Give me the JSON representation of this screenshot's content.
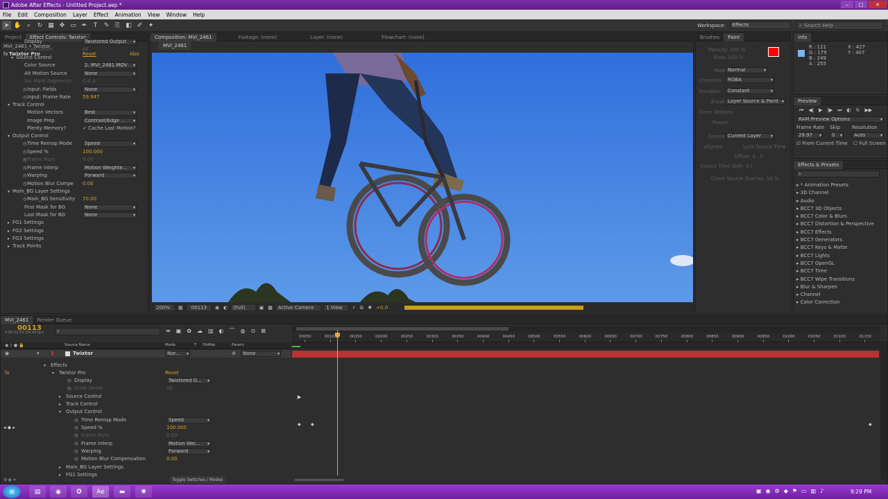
{
  "window_title": "Adobe After Effects - Untitled Project.aep *",
  "menu": [
    "File",
    "Edit",
    "Composition",
    "Layer",
    "Effect",
    "Animation",
    "View",
    "Window",
    "Help"
  ],
  "workspace": {
    "label": "Workspace:",
    "value": "Effects"
  },
  "search_help": "Search Help",
  "effect_controls": {
    "tabs": [
      "Project",
      "Effect Controls: Twixtor"
    ],
    "layer_path": "MVI_2461 • Twixtor",
    "effect_name": "Twixtor Pro",
    "reset": "Reset",
    "about": "Abo",
    "rows": [
      {
        "label": "Display",
        "value": "Twixtored Output"
      },
      {
        "label": "Draw Geom",
        "value": "All"
      },
      {
        "label": "Source Control",
        "value": ""
      },
      {
        "label": "Color Source",
        "value": "2. MVI_2461.MOV"
      },
      {
        "label": "Alt Motion Source",
        "value": "None"
      },
      {
        "label": "Src Mark Segments",
        "value": "Cut A"
      },
      {
        "label": "Input: Fields",
        "value": "None"
      },
      {
        "label": "Input: Frame Rate",
        "value": "59.947"
      },
      {
        "label": "Track Control",
        "value": ""
      },
      {
        "label": "Motion Vectors",
        "value": "Best"
      },
      {
        "label": "Image Prep",
        "value": "Contrast/Edge ..."
      },
      {
        "label": "Plenty Memory?",
        "value": "Cache Last Motion?"
      },
      {
        "label": "Output Control",
        "value": ""
      },
      {
        "label": "Time Remap Mode",
        "value": "Speed"
      },
      {
        "label": "Speed %",
        "value": "100.000"
      },
      {
        "label": "Frame Num",
        "value": "0.00"
      },
      {
        "label": "Frame Interp",
        "value": "Motion Weighte..."
      },
      {
        "label": "Warping",
        "value": "Forward"
      },
      {
        "label": "Motion Blur Compe",
        "value": "0.00"
      },
      {
        "label": "Main_BG Layer Settings",
        "value": ""
      },
      {
        "label": "Main_BG Sensitivity",
        "value": "70.00"
      },
      {
        "label": "First Mask for BG",
        "value": "None"
      },
      {
        "label": "Last Mask for BG",
        "value": "None"
      },
      {
        "label": "FG1 Settings",
        "value": ""
      },
      {
        "label": "FG2 Settings",
        "value": ""
      },
      {
        "label": "FG3 Settings",
        "value": ""
      },
      {
        "label": "Track Points",
        "value": ""
      }
    ]
  },
  "composition": {
    "tabs": [
      "Composition: MVI_2461",
      "Footage: (none)",
      "Layer: (none)",
      "Flowchart: (none)"
    ],
    "subtab": "MVI_2461",
    "zoom": "200%",
    "timecode": "00113",
    "resolution": "(Full)",
    "camera": "Active Camera",
    "views": "1 View",
    "exposure": "+0.0"
  },
  "paint": {
    "tabs": [
      "Brushes",
      "Paint"
    ],
    "opacity": "Opacity: 100 %",
    "flow": "Flow: 100 %",
    "mode_label": "Mode:",
    "mode": "Normal",
    "channels_label": "Channels:",
    "channels": "RGBA",
    "duration_label": "Duration:",
    "duration": "Constant",
    "erase_label": "Erase:",
    "erase": "Layer Source & Paint",
    "clone_options": "Clone Options",
    "preset": "Preset:",
    "source_label": "Source:",
    "source": "Current Layer",
    "aligned": "Aligned",
    "lock_source": "Lock Source Time",
    "offset": "Offset: 0 , 0",
    "source_time_shift": "Source Time Shift: 0 f",
    "clone_overlay": "Clone Source Overlay: 50 %"
  },
  "info": {
    "tab": "Info",
    "r": "R : 121",
    "g": "G : 179",
    "b": "B : 249",
    "a": "A : 255",
    "x": "X : 427",
    "y": "Y : 407"
  },
  "preview": {
    "tab": "Preview",
    "ram": "RAM Preview Options",
    "frame_rate_label": "Frame Rate",
    "skip_label": "Skip",
    "resolution_label": "Resolution",
    "frame_rate": "29.97",
    "skip": "0",
    "resolution": "Auto",
    "from_current": "From Current Time",
    "full_screen": "Full Screen"
  },
  "effects_presets": {
    "tab": "Effects & Presets",
    "items": [
      "* Animation Presets",
      "3D Channel",
      "Audio",
      "BCC7 3D Objects",
      "BCC7 Color & Blurs",
      "BCC7 Distortion & Perspective",
      "BCC7 Effects",
      "BCC7 Generators",
      "BCC7 Keys & Matte",
      "BCC7 Lights",
      "BCC7 OpenGL",
      "BCC7 Time",
      "BCC7 Wipe Transitions",
      "Blur & Sharpen",
      "Channel",
      "Color Correction"
    ]
  },
  "timeline": {
    "tabs": [
      "MVI_2461",
      "Render Queue"
    ],
    "timecode": "00113",
    "timecode_sub": "0:00:01:53 (59.94 fps)",
    "col_source": "Source Name",
    "col_mode": "Mode",
    "col_t": "T",
    "col_trkmat": "TrkMat",
    "col_parent": "Parent",
    "layer_num": "1",
    "layer_name": "Twixtor",
    "layer_mode": "Nor...",
    "layer_parent": "None",
    "rows": [
      {
        "label": "Effects",
        "value": ""
      },
      {
        "label": "Twixtor Pro",
        "value": "Reset"
      },
      {
        "label": "Display",
        "value": "Twixtored O..."
      },
      {
        "label": "Draw Geom",
        "value": "All"
      },
      {
        "label": "Source Control",
        "value": ""
      },
      {
        "label": "Track Control",
        "value": ""
      },
      {
        "label": "Output Control",
        "value": ""
      },
      {
        "label": "Time Remap Mode",
        "value": "Speed"
      },
      {
        "label": "Speed %",
        "value": "100.000"
      },
      {
        "label": "Frame Num",
        "value": "0.00"
      },
      {
        "label": "Frame Interp",
        "value": "Motion Wei..."
      },
      {
        "label": "Warping",
        "value": "Forward"
      },
      {
        "label": "Motion Blur Compensation",
        "value": "0.00"
      },
      {
        "label": "Main_BG Layer Settings",
        "value": ""
      },
      {
        "label": "FG1 Settings",
        "value": ""
      }
    ],
    "toggle_label": "Toggle Switches / Modes",
    "ruler": [
      "00050",
      "00100",
      "00150",
      "00200",
      "00250",
      "00300",
      "00350",
      "00400",
      "00450",
      "00500",
      "00550",
      "00600",
      "00650",
      "00700",
      "00750",
      "00800",
      "00850",
      "00900",
      "00950",
      "01000",
      "01050",
      "01100",
      "01150"
    ]
  },
  "clock": "9:29 PM",
  "colors": {
    "fg_swatch": "#ff0000",
    "sky": "#3c7de0",
    "layer_bar": "#b83232",
    "cti": "#e8a838",
    "taskbar": "#7b28b0"
  }
}
